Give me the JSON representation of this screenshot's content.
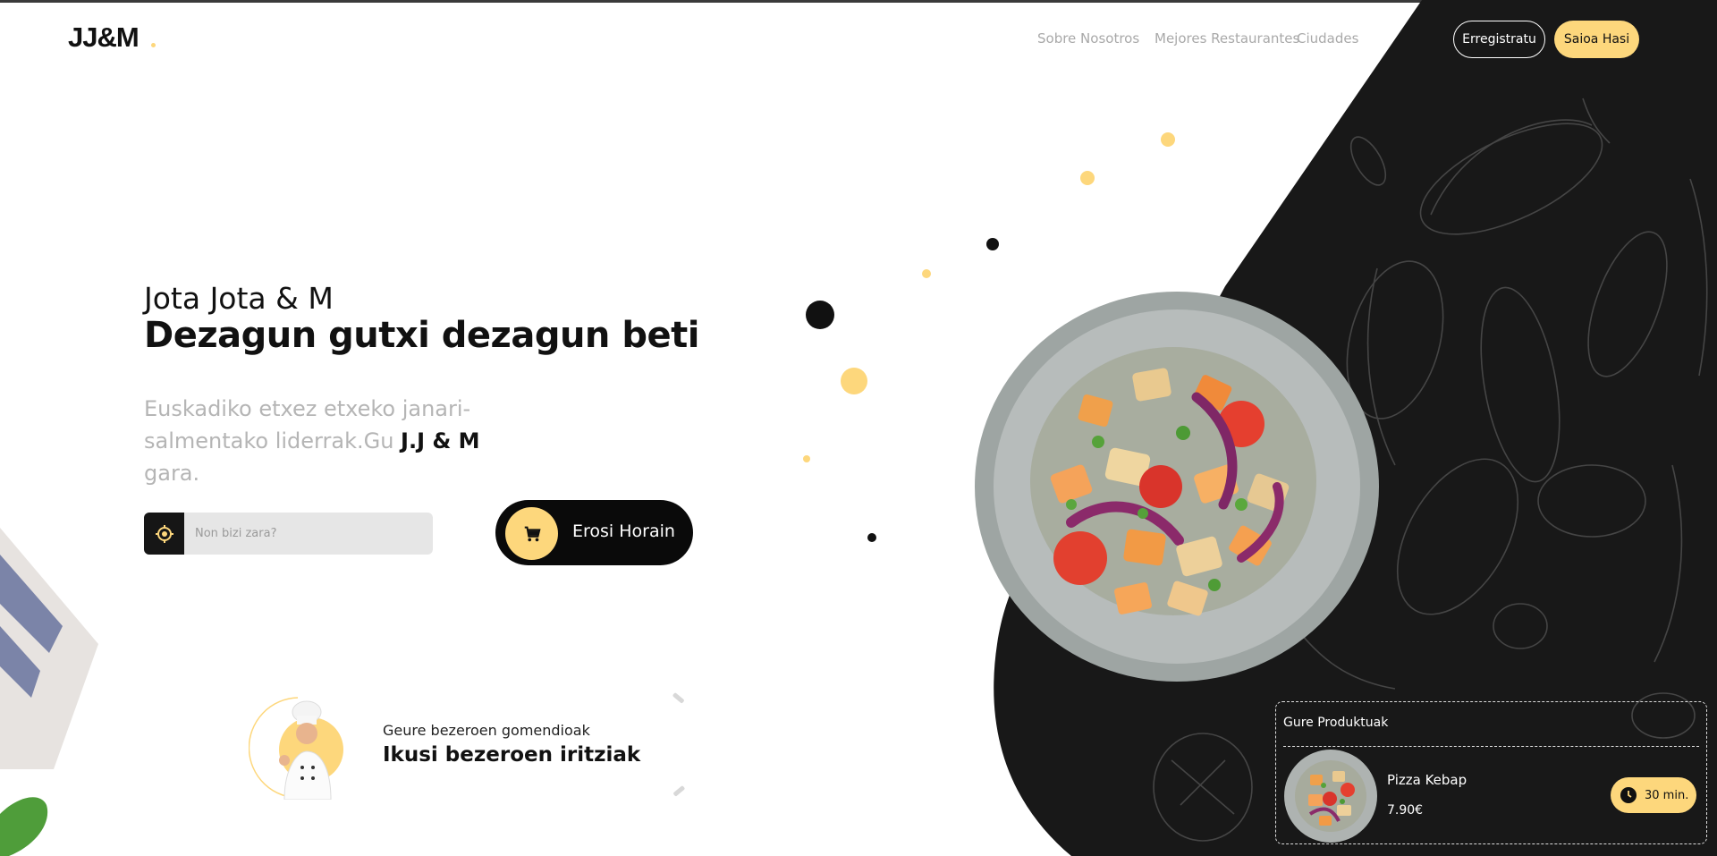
{
  "brand": {
    "logo": "JJ&M"
  },
  "nav": {
    "items": [
      "Sobre Nosotros",
      "Mejores Restaurantes",
      "Ciudades"
    ],
    "register_label": "Erregistratu",
    "login_label": "Saioa Hasi"
  },
  "hero": {
    "subtitle": "Jota Jota & M",
    "title": "Dezagun gutxi dezagun beti",
    "description_prefix": "Euskadiko etxez etxeko janari-salmentako liderrak.Gu ",
    "description_brand": "J.J & M",
    "description_suffix": " gara."
  },
  "search": {
    "placeholder": "Non bizi zara?"
  },
  "cta": {
    "buy_label": "Erosi Horain"
  },
  "reviews": {
    "small": "Geure bezeroen gomendioak",
    "big": "Ikusi bezeroen iritziak"
  },
  "products": {
    "heading": "Gure Produktuak",
    "items": [
      {
        "name": "Pizza Kebap",
        "price": "7.90€",
        "time": "30 min."
      }
    ]
  },
  "colors": {
    "accent": "#fdd77c",
    "dark": "#161616"
  },
  "icons": [
    "location-target-icon",
    "cart-icon",
    "clock-icon"
  ]
}
